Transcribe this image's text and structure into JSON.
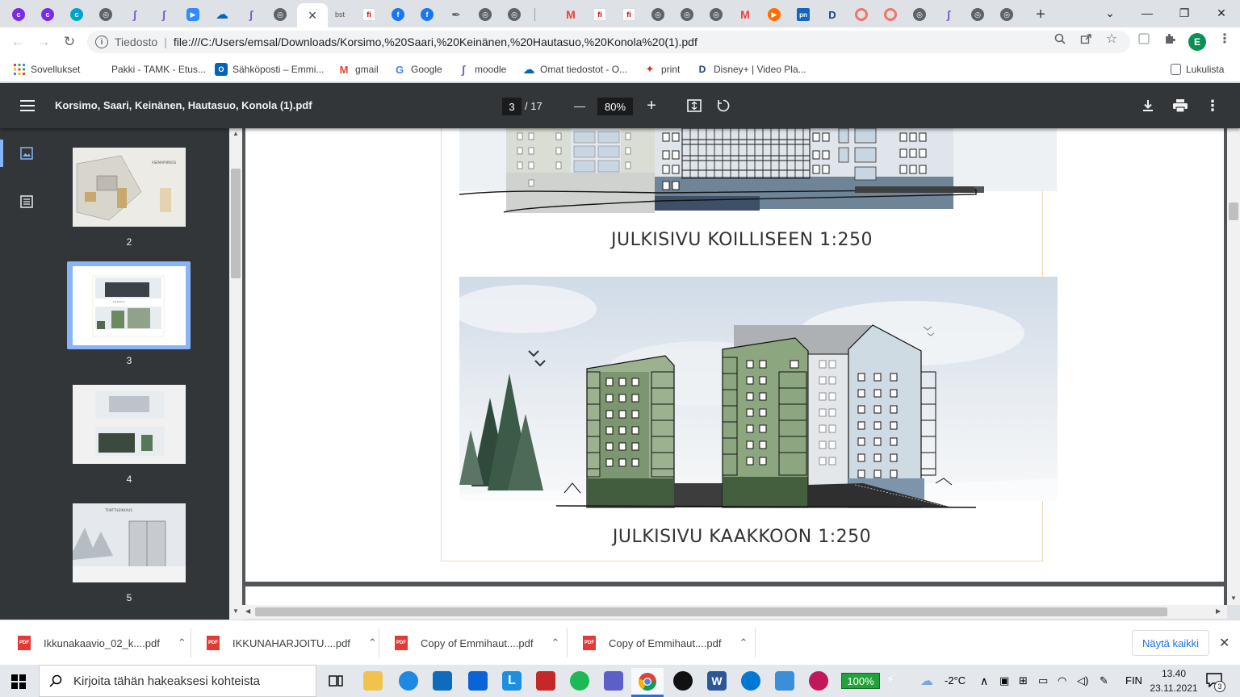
{
  "tabs": {
    "active_close": "×",
    "new_tab": "+",
    "bst_label": "bst",
    "pn_label": "pn",
    "fi_label": "fi",
    "gmail_letter": "M"
  },
  "window": {
    "minimize": "—",
    "restore": "❐",
    "close": "✕",
    "tabsearch": "⌄"
  },
  "toolbar": {
    "back": "←",
    "forward": "→",
    "reload": "↻",
    "info": "i",
    "secure_label": "Tiedosto",
    "url": "file:///C:/Users/emsal/Downloads/Korsimo,%20Saari,%20Keinänen,%20Hautasuo,%20Konola%20(1).pdf",
    "avatar_letter": "E"
  },
  "bookmarks": [
    {
      "label": "Sovellukset"
    },
    {
      "label": "Pakki - TAMK - Etus..."
    },
    {
      "label": "Sähköposti – Emmi..."
    },
    {
      "label": "gmail"
    },
    {
      "label": "Google"
    },
    {
      "label": "moodle"
    },
    {
      "label": "Omat tiedostot - O..."
    },
    {
      "label": "print"
    },
    {
      "label": "Disney+ | Video Pla..."
    }
  ],
  "reading_list": "Lukulista",
  "pdf": {
    "title": "Korsimo, Saari, Keinänen, Hautasuo, Konola (1).pdf",
    "current_page": "3",
    "total_pages": "/ 17",
    "zoom": "80%",
    "zoom_out": "—",
    "zoom_in": "+",
    "caption_1": "JULKISIVU KOILLISEEN 1:250",
    "caption_2": "JULKISIVU KAAKKOON 1:250"
  },
  "thumbnails": [
    {
      "num": "2"
    },
    {
      "num": "3"
    },
    {
      "num": "4"
    },
    {
      "num": "5"
    }
  ],
  "downloads": [
    {
      "name": "Ikkunakaavio_02_k....pdf"
    },
    {
      "name": "IKKUNAHARJOITU....pdf"
    },
    {
      "name": "Copy of Emmihaut....pdf"
    },
    {
      "name": "Copy of Emmihaut....pdf"
    }
  ],
  "downloads_pdf_badge": "PDF",
  "show_all": "Näytä kaikki",
  "taskbar": {
    "search_placeholder": "Kirjoita tähän hakeaksesi kohteista",
    "battery": "100%",
    "temperature": "-2°C",
    "language": "FIN",
    "time": "13.40",
    "date": "23.11.2021",
    "notification_count": "3",
    "word_letter": "W",
    "learn_letter": "L"
  },
  "colors": {
    "pdf_toolbar": "#323639",
    "viewer_bg": "#525659",
    "accent_blue": "#1a73e8",
    "thumb_selected": "#8ab4f8"
  }
}
